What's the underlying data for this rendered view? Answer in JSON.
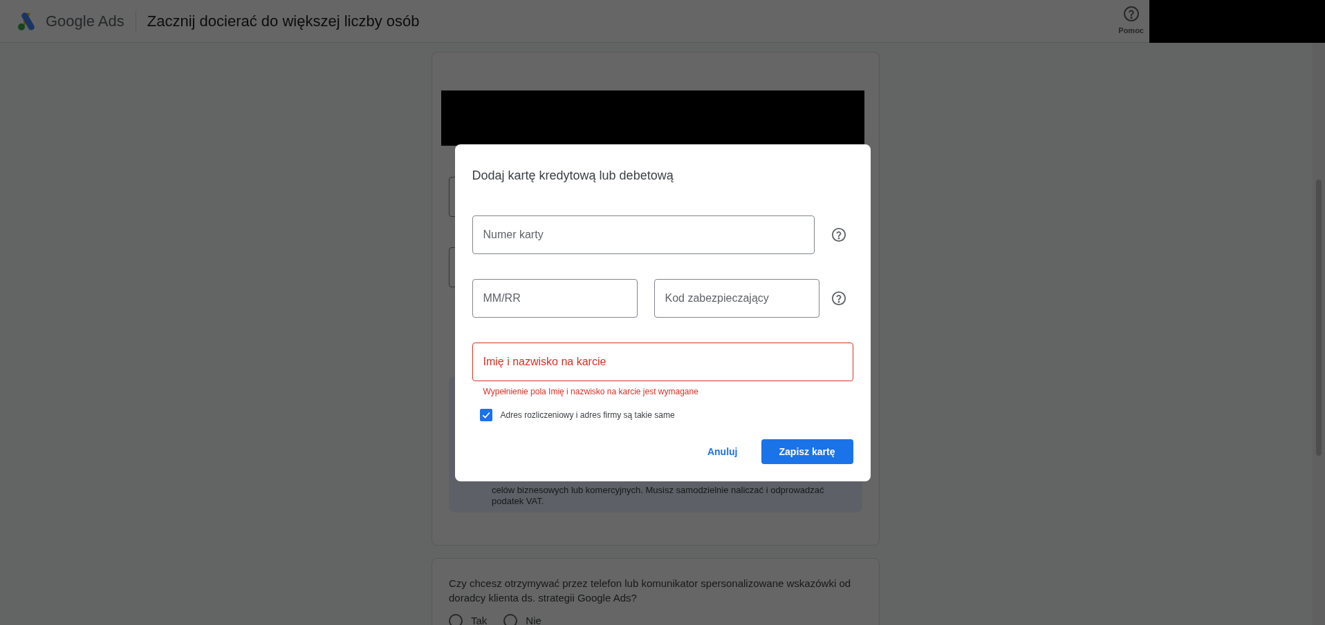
{
  "header": {
    "logo_text": "Google Ads",
    "title": "Zacznij docierać do większej liczby osób",
    "help_label": "Pomoc"
  },
  "background": {
    "vat_note": "celów biznesowych lub komercyjnych. Musisz samodzielnie naliczać i odprowadzać podatek VAT.",
    "question": "Czy chcesz otrzymywać przez telefon lub komunikator spersonalizowane wskazówki od doradcy klienta ds. strategii Google Ads?",
    "radios": [
      {
        "label": "Tak",
        "selected": false
      },
      {
        "label": "Nie",
        "selected": false
      }
    ]
  },
  "dialog": {
    "title": "Dodaj kartę kredytową lub debetową",
    "field_rows": [
      {
        "help": true,
        "fields": [
          {
            "placeholder": "Numer karty",
            "invalid": false
          }
        ]
      },
      {
        "help": true,
        "fields": [
          {
            "placeholder": "MM/RR",
            "invalid": false
          },
          {
            "placeholder": "Kod zabezpieczający",
            "invalid": false
          }
        ]
      },
      {
        "help": false,
        "fields": [
          {
            "placeholder": "Imię i nazwisko na karcie",
            "invalid": true
          }
        ]
      }
    ],
    "error_message": "Wypełnienie pola Imię i nazwisko na karcie jest wymagane",
    "checkbox": {
      "label": "Adres rozliczeniowy i adres firmy są takie same",
      "checked": true
    },
    "cancel_label": "Anuluj",
    "save_label": "Zapisz kartę"
  }
}
